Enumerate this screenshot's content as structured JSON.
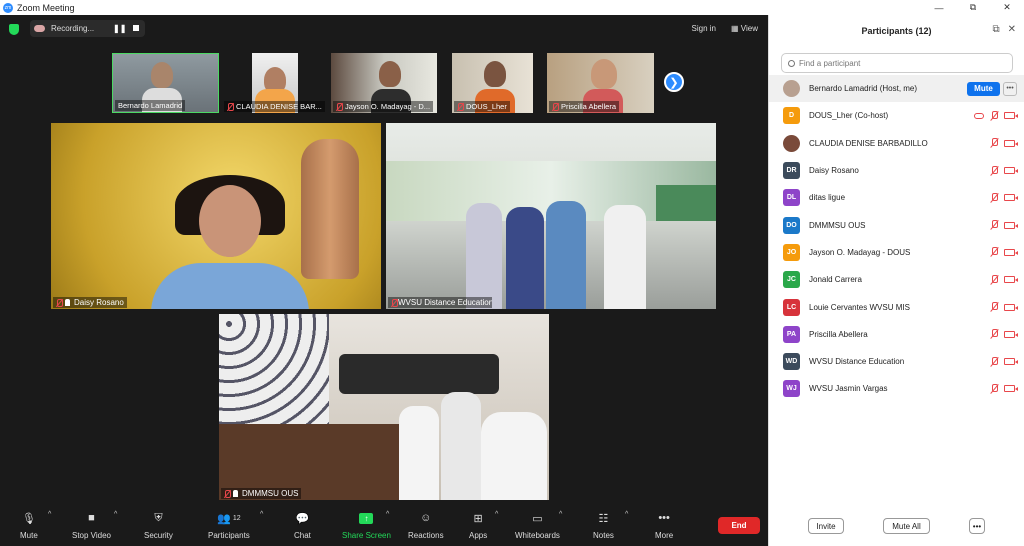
{
  "window": {
    "title": "Zoom Meeting",
    "logo_text": "zm",
    "minimize": "—",
    "maximize": "⧉",
    "close": "✕"
  },
  "topbar": {
    "recording_label": "Recording...",
    "pause_symbol": "❚❚",
    "sign_in": "Sign in",
    "view": "View",
    "view_icon": "▦"
  },
  "thumbnails": [
    {
      "name": "Bernardo Lamadrid",
      "muted": false,
      "active": true
    },
    {
      "name": "CLAUDIA DENISE BAR...",
      "muted": true
    },
    {
      "name": "Jayson O. Madayag - D...",
      "muted": true
    },
    {
      "name": "DOUS_Lher",
      "muted": true
    },
    {
      "name": "Priscilla Abellera",
      "muted": true
    }
  ],
  "next_arrow": "❯",
  "tiles": [
    {
      "name": "Daisy Rosano"
    },
    {
      "name": "WVSU Distance Education"
    },
    {
      "name": "DMMMSU OUS"
    }
  ],
  "toolbar": {
    "mute": "Mute",
    "stop_video": "Stop Video",
    "security": "Security",
    "participants": "Participants",
    "participants_count": "12",
    "chat": "Chat",
    "share_screen": "Share Screen",
    "reactions": "Reactions",
    "apps": "Apps",
    "whiteboards": "Whiteboards",
    "notes": "Notes",
    "more": "More",
    "end": "End",
    "caret": "^",
    "icons": {
      "mic": "🎙",
      "video": "■",
      "security": "⛨",
      "participants": "👥",
      "chat": "💬",
      "share": "↑",
      "reactions": "☺",
      "apps": "⊞",
      "whiteboards": "▭",
      "notes": "☷",
      "more": "•••"
    }
  },
  "panel": {
    "title": "Participants (12)",
    "popout_icon": "⧉",
    "close_icon": "✕",
    "search_placeholder": "Find a participant",
    "participants": [
      {
        "name": "Bernardo Lamadrid (Host, me)",
        "initials": "",
        "color": "#8a6a5a",
        "photo": true,
        "me": true
      },
      {
        "name": "DOUS_Lher (Co-host)",
        "initials": "D",
        "color": "#f59b0c",
        "recording": true
      },
      {
        "name": "CLAUDIA DENISE BARBADILLO",
        "initials": "",
        "color": "#8a5a4a",
        "photo": true
      },
      {
        "name": "Daisy Rosano",
        "initials": "DR",
        "color": "#3c4b5c"
      },
      {
        "name": "ditas ligue",
        "initials": "DL",
        "color": "#8e44c9"
      },
      {
        "name": "DMMMSU OUS",
        "initials": "DO",
        "color": "#1b79c9"
      },
      {
        "name": "Jayson O. Madayag - DOUS",
        "initials": "JO",
        "color": "#f59b0c"
      },
      {
        "name": "Jonald Carrera",
        "initials": "JC",
        "color": "#2aa84a"
      },
      {
        "name": "Louie Cervantes WVSU MIS",
        "initials": "LC",
        "color": "#d7333b"
      },
      {
        "name": "Priscilla Abellera",
        "initials": "PA",
        "color": "#8e44c9"
      },
      {
        "name": "WVSU Distance Education",
        "initials": "WD",
        "color": "#3c4b5c"
      },
      {
        "name": "WVSU Jasmin Vargas",
        "initials": "WJ",
        "color": "#8e44c9"
      }
    ],
    "mute_button": "Mute",
    "more_button": "•••",
    "invite": "Invite",
    "mute_all": "Mute All"
  },
  "colors": {
    "accent": "#0e72ed",
    "end_red": "#e02828",
    "share_green": "#23d959"
  }
}
